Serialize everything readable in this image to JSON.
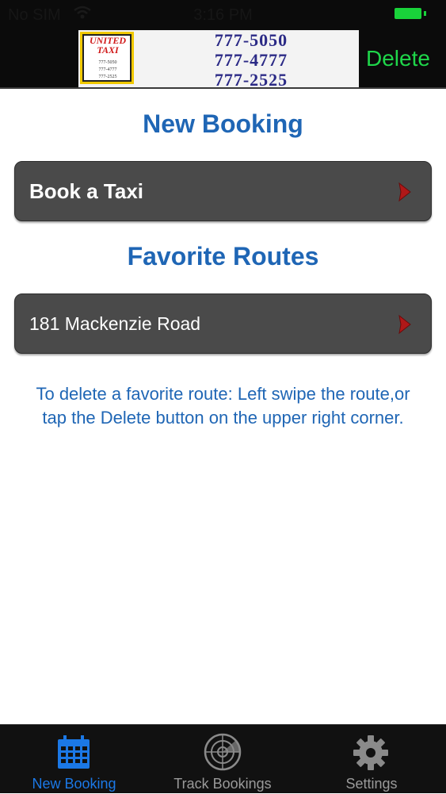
{
  "status_bar": {
    "carrier": "No SIM",
    "time": "3:16 PM",
    "battery_color": "#19d33a"
  },
  "ad": {
    "logo_line1": "UNITED",
    "logo_line2": "TAXI",
    "logo_numbers": [
      "777-5050",
      "777-4777",
      "777-2525"
    ],
    "phones": [
      "777-5050",
      "777-4777",
      "777-2525"
    ]
  },
  "nav": {
    "delete_label": "Delete"
  },
  "new_booking": {
    "title": "New Booking",
    "book_taxi_label": "Book a Taxi"
  },
  "favorites": {
    "title": "Favorite Routes",
    "routes": [
      "181 Mackenzie Road"
    ]
  },
  "hint": {
    "text": "To delete a favorite route: Left swipe the route,or tap the Delete button on the upper right corner."
  },
  "tabs": [
    {
      "label": "New Booking",
      "icon": "calendar-icon",
      "active": true
    },
    {
      "label": "Track Bookings",
      "icon": "radar-icon",
      "active": false
    },
    {
      "label": "Settings",
      "icon": "gear-icon",
      "active": false
    }
  ],
  "colors": {
    "accent_blue": "#1f66b5",
    "tab_active": "#1b78e6",
    "delete_green": "#1fd64a",
    "row_bg": "#4a4a4a",
    "chevron_red": "#b01818"
  }
}
